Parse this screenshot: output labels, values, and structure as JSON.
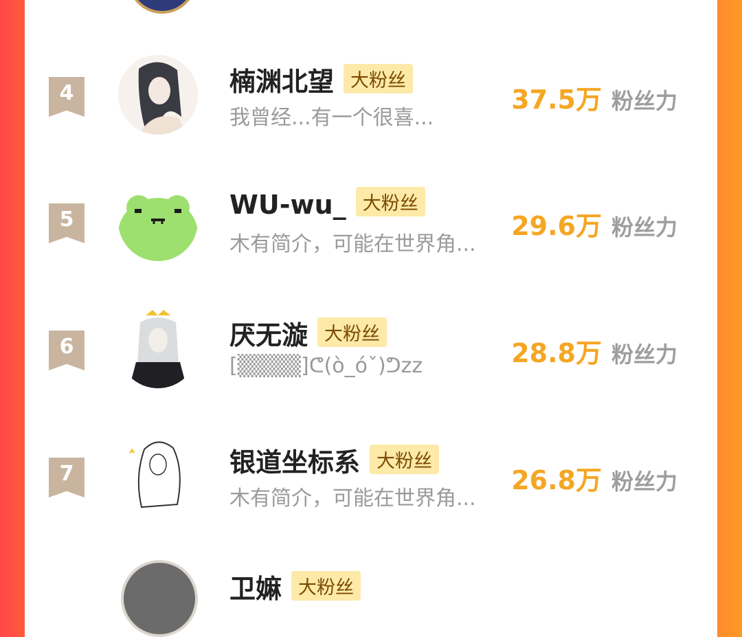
{
  "rows": [
    {
      "rank": "4",
      "name": "楠渊北望",
      "badge": "大粉丝",
      "bio": "我曾经...有一个很喜...",
      "fans_value": "37.5万",
      "fans_unit": "粉丝力"
    },
    {
      "rank": "5",
      "name": "WU-wu_",
      "badge": "大粉丝",
      "bio": "木有简介，可能在世界角...",
      "fans_value": "29.6万",
      "fans_unit": "粉丝力"
    },
    {
      "rank": "6",
      "name": "厌无漩",
      "badge": "大粉丝",
      "bio": "[▒▒▒▒]ᕦ(ò_óˇ)ᕤzz",
      "fans_value": "28.8万",
      "fans_unit": "粉丝力"
    },
    {
      "rank": "7",
      "name": "银道坐标系",
      "badge": "大粉丝",
      "bio": "木有简介，可能在世界角...",
      "fans_value": "26.8万",
      "fans_unit": "粉丝力"
    }
  ],
  "partial_bottom": {
    "name": "卫嫲",
    "badge": "大粉丝"
  },
  "colors": {
    "rank_bg": "#c9b59f",
    "badge_bg": "#fde9a8",
    "fans_value": "#f5a623"
  }
}
